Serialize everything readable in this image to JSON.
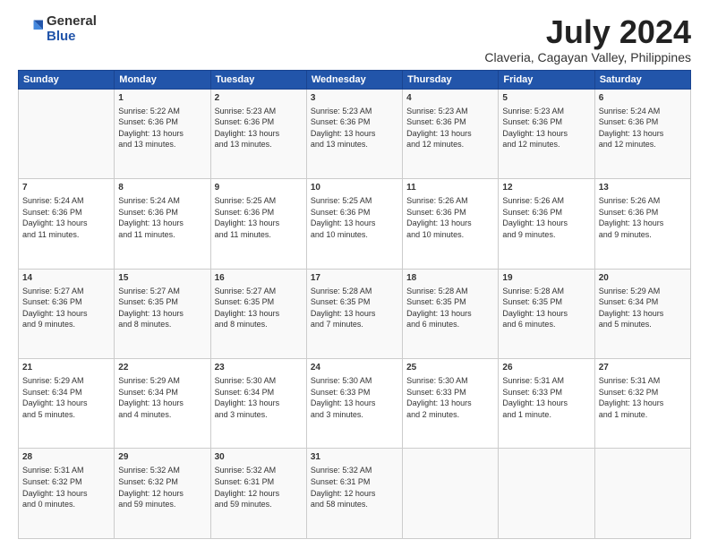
{
  "logo": {
    "general": "General",
    "blue": "Blue"
  },
  "title": "July 2024",
  "subtitle": "Claveria, Cagayan Valley, Philippines",
  "headers": [
    "Sunday",
    "Monday",
    "Tuesday",
    "Wednesday",
    "Thursday",
    "Friday",
    "Saturday"
  ],
  "weeks": [
    [
      {
        "day": "",
        "lines": []
      },
      {
        "day": "1",
        "lines": [
          "Sunrise: 5:22 AM",
          "Sunset: 6:36 PM",
          "Daylight: 13 hours",
          "and 13 minutes."
        ]
      },
      {
        "day": "2",
        "lines": [
          "Sunrise: 5:23 AM",
          "Sunset: 6:36 PM",
          "Daylight: 13 hours",
          "and 13 minutes."
        ]
      },
      {
        "day": "3",
        "lines": [
          "Sunrise: 5:23 AM",
          "Sunset: 6:36 PM",
          "Daylight: 13 hours",
          "and 13 minutes."
        ]
      },
      {
        "day": "4",
        "lines": [
          "Sunrise: 5:23 AM",
          "Sunset: 6:36 PM",
          "Daylight: 13 hours",
          "and 12 minutes."
        ]
      },
      {
        "day": "5",
        "lines": [
          "Sunrise: 5:23 AM",
          "Sunset: 6:36 PM",
          "Daylight: 13 hours",
          "and 12 minutes."
        ]
      },
      {
        "day": "6",
        "lines": [
          "Sunrise: 5:24 AM",
          "Sunset: 6:36 PM",
          "Daylight: 13 hours",
          "and 12 minutes."
        ]
      }
    ],
    [
      {
        "day": "7",
        "lines": [
          "Sunrise: 5:24 AM",
          "Sunset: 6:36 PM",
          "Daylight: 13 hours",
          "and 11 minutes."
        ]
      },
      {
        "day": "8",
        "lines": [
          "Sunrise: 5:24 AM",
          "Sunset: 6:36 PM",
          "Daylight: 13 hours",
          "and 11 minutes."
        ]
      },
      {
        "day": "9",
        "lines": [
          "Sunrise: 5:25 AM",
          "Sunset: 6:36 PM",
          "Daylight: 13 hours",
          "and 11 minutes."
        ]
      },
      {
        "day": "10",
        "lines": [
          "Sunrise: 5:25 AM",
          "Sunset: 6:36 PM",
          "Daylight: 13 hours",
          "and 10 minutes."
        ]
      },
      {
        "day": "11",
        "lines": [
          "Sunrise: 5:26 AM",
          "Sunset: 6:36 PM",
          "Daylight: 13 hours",
          "and 10 minutes."
        ]
      },
      {
        "day": "12",
        "lines": [
          "Sunrise: 5:26 AM",
          "Sunset: 6:36 PM",
          "Daylight: 13 hours",
          "and 9 minutes."
        ]
      },
      {
        "day": "13",
        "lines": [
          "Sunrise: 5:26 AM",
          "Sunset: 6:36 PM",
          "Daylight: 13 hours",
          "and 9 minutes."
        ]
      }
    ],
    [
      {
        "day": "14",
        "lines": [
          "Sunrise: 5:27 AM",
          "Sunset: 6:36 PM",
          "Daylight: 13 hours",
          "and 9 minutes."
        ]
      },
      {
        "day": "15",
        "lines": [
          "Sunrise: 5:27 AM",
          "Sunset: 6:35 PM",
          "Daylight: 13 hours",
          "and 8 minutes."
        ]
      },
      {
        "day": "16",
        "lines": [
          "Sunrise: 5:27 AM",
          "Sunset: 6:35 PM",
          "Daylight: 13 hours",
          "and 8 minutes."
        ]
      },
      {
        "day": "17",
        "lines": [
          "Sunrise: 5:28 AM",
          "Sunset: 6:35 PM",
          "Daylight: 13 hours",
          "and 7 minutes."
        ]
      },
      {
        "day": "18",
        "lines": [
          "Sunrise: 5:28 AM",
          "Sunset: 6:35 PM",
          "Daylight: 13 hours",
          "and 6 minutes."
        ]
      },
      {
        "day": "19",
        "lines": [
          "Sunrise: 5:28 AM",
          "Sunset: 6:35 PM",
          "Daylight: 13 hours",
          "and 6 minutes."
        ]
      },
      {
        "day": "20",
        "lines": [
          "Sunrise: 5:29 AM",
          "Sunset: 6:34 PM",
          "Daylight: 13 hours",
          "and 5 minutes."
        ]
      }
    ],
    [
      {
        "day": "21",
        "lines": [
          "Sunrise: 5:29 AM",
          "Sunset: 6:34 PM",
          "Daylight: 13 hours",
          "and 5 minutes."
        ]
      },
      {
        "day": "22",
        "lines": [
          "Sunrise: 5:29 AM",
          "Sunset: 6:34 PM",
          "Daylight: 13 hours",
          "and 4 minutes."
        ]
      },
      {
        "day": "23",
        "lines": [
          "Sunrise: 5:30 AM",
          "Sunset: 6:34 PM",
          "Daylight: 13 hours",
          "and 3 minutes."
        ]
      },
      {
        "day": "24",
        "lines": [
          "Sunrise: 5:30 AM",
          "Sunset: 6:33 PM",
          "Daylight: 13 hours",
          "and 3 minutes."
        ]
      },
      {
        "day": "25",
        "lines": [
          "Sunrise: 5:30 AM",
          "Sunset: 6:33 PM",
          "Daylight: 13 hours",
          "and 2 minutes."
        ]
      },
      {
        "day": "26",
        "lines": [
          "Sunrise: 5:31 AM",
          "Sunset: 6:33 PM",
          "Daylight: 13 hours",
          "and 1 minute."
        ]
      },
      {
        "day": "27",
        "lines": [
          "Sunrise: 5:31 AM",
          "Sunset: 6:32 PM",
          "Daylight: 13 hours",
          "and 1 minute."
        ]
      }
    ],
    [
      {
        "day": "28",
        "lines": [
          "Sunrise: 5:31 AM",
          "Sunset: 6:32 PM",
          "Daylight: 13 hours",
          "and 0 minutes."
        ]
      },
      {
        "day": "29",
        "lines": [
          "Sunrise: 5:32 AM",
          "Sunset: 6:32 PM",
          "Daylight: 12 hours",
          "and 59 minutes."
        ]
      },
      {
        "day": "30",
        "lines": [
          "Sunrise: 5:32 AM",
          "Sunset: 6:31 PM",
          "Daylight: 12 hours",
          "and 59 minutes."
        ]
      },
      {
        "day": "31",
        "lines": [
          "Sunrise: 5:32 AM",
          "Sunset: 6:31 PM",
          "Daylight: 12 hours",
          "and 58 minutes."
        ]
      },
      {
        "day": "",
        "lines": []
      },
      {
        "day": "",
        "lines": []
      },
      {
        "day": "",
        "lines": []
      }
    ]
  ]
}
